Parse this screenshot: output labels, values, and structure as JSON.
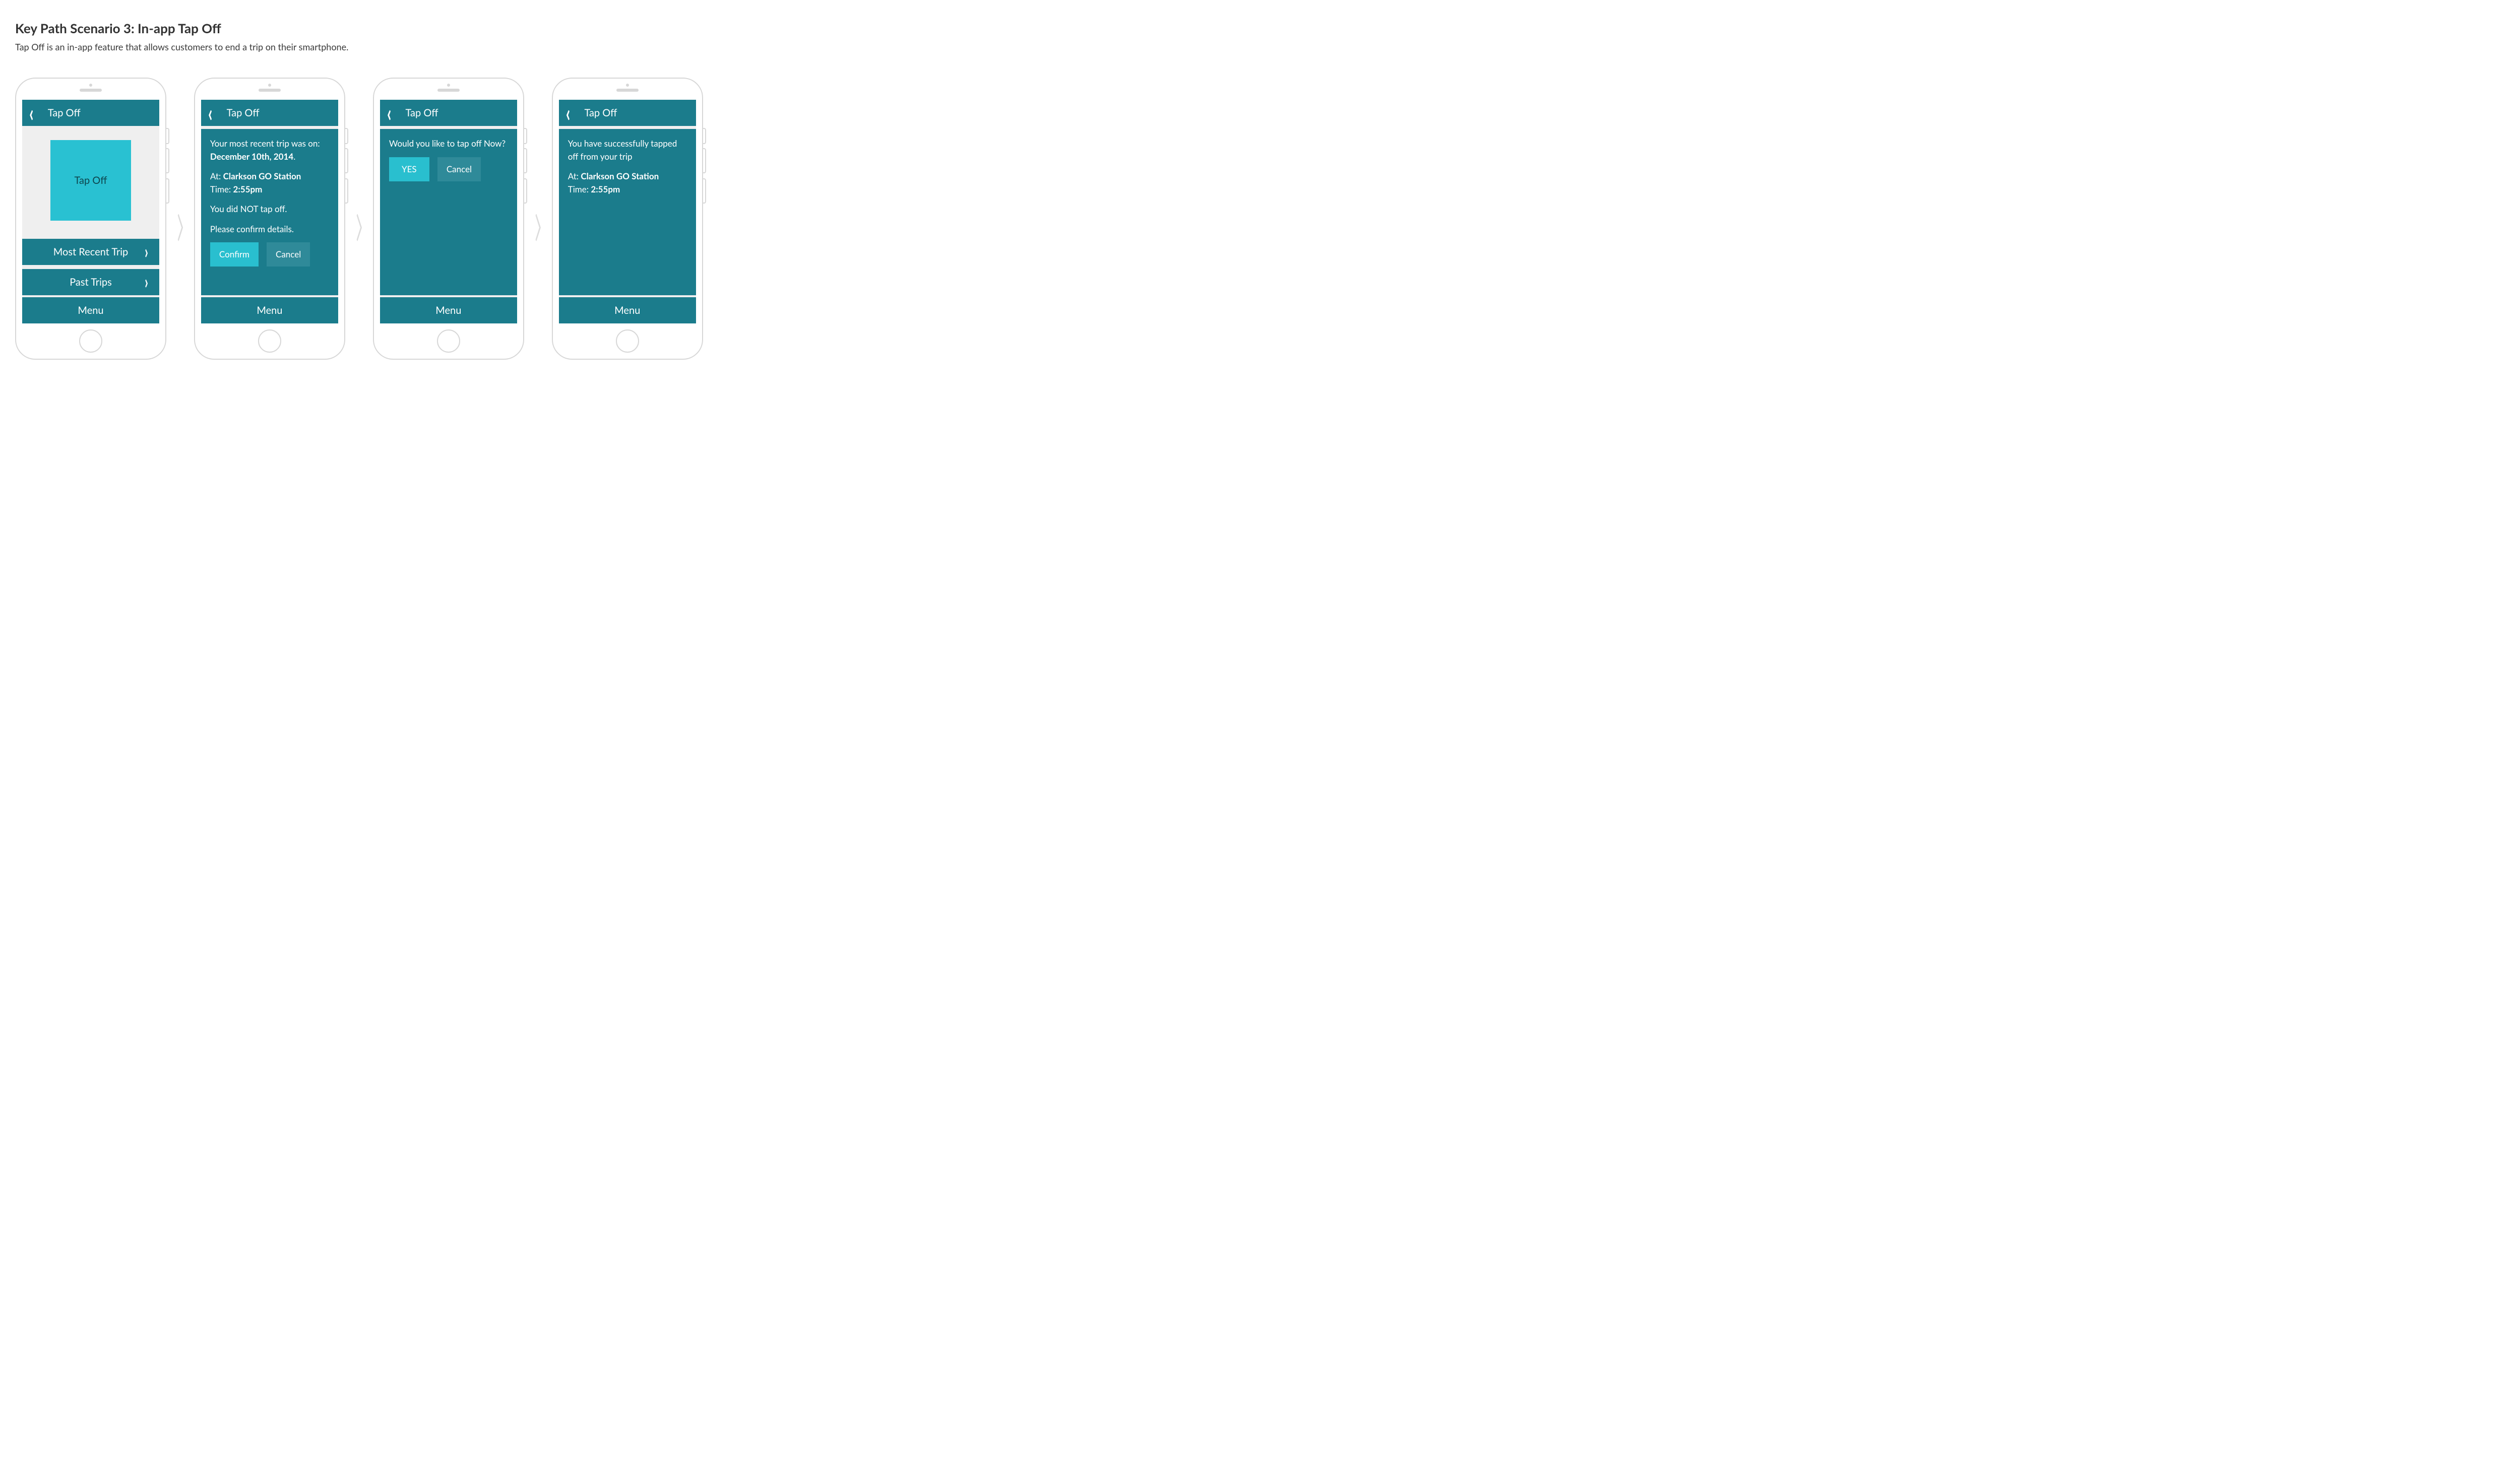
{
  "heading": "Key Path Scenario 3: In-app Tap Off",
  "subheading": "Tap Off is an in-app feature that allows customers to end a trip on their smartphone.",
  "common": {
    "header_title": "Tap Off",
    "menu_label": "Menu"
  },
  "screen1": {
    "tapoff_button": "Tap Off",
    "nav_recent": "Most Recent Trip",
    "nav_past": "Past Trips"
  },
  "screen2": {
    "line1_prefix": "Your most recent trip was on: ",
    "line1_bold": "December 10th, 2014",
    "line1_suffix": ".",
    "at_prefix": "At: ",
    "at_bold": "Clarkson GO Station",
    "time_prefix": "Time: ",
    "time_bold": "2:55pm",
    "not_tapped": "You did NOT tap off.",
    "confirm_prompt": "Please confirm details.",
    "confirm_btn": "Confirm",
    "cancel_btn": "Cancel"
  },
  "screen3": {
    "prompt": "Would you like to tap off Now?",
    "yes_btn": "YES",
    "cancel_btn": "Cancel"
  },
  "screen4": {
    "line1": "You have successfully tapped off from your trip",
    "at_prefix": "At: ",
    "at_bold": "Clarkson GO Station",
    "time_prefix": "Time: ",
    "time_bold": "2:55pm"
  }
}
